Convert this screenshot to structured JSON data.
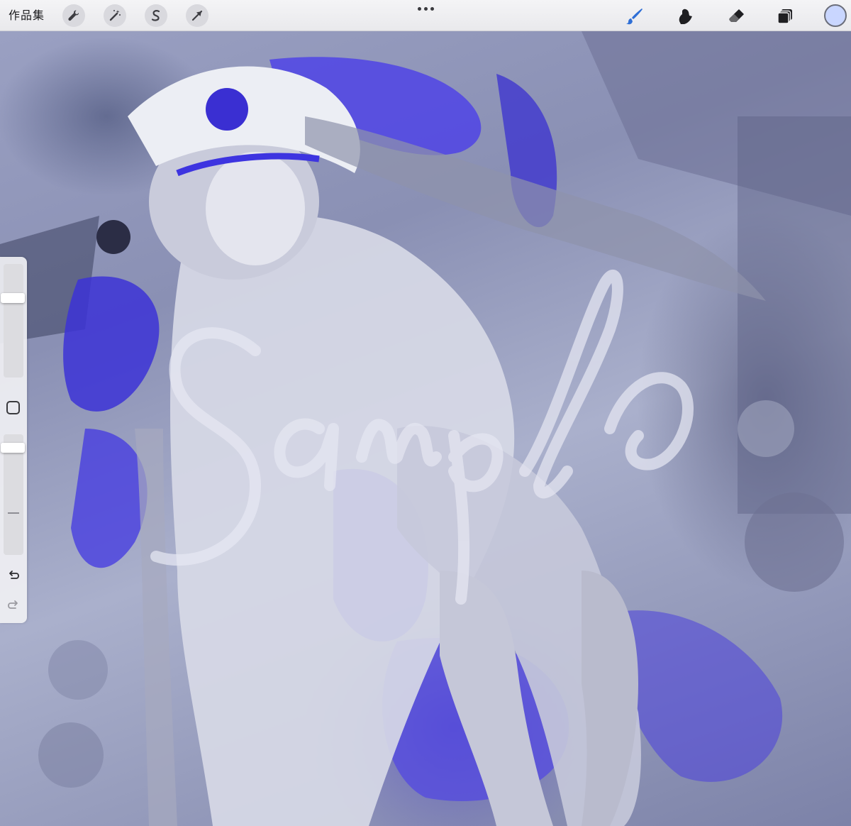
{
  "app": {
    "gallery_label": "作品集"
  },
  "toolbar": {
    "left_tools": [
      {
        "name": "actions",
        "icon": "wrench-icon"
      },
      {
        "name": "adjustments",
        "icon": "magic-wand-icon"
      },
      {
        "name": "selection",
        "icon": "selection-s-icon"
      },
      {
        "name": "transform",
        "icon": "arrow-cursor-icon"
      }
    ],
    "more_icon": "more-dots-icon",
    "right_tools": [
      {
        "name": "brush",
        "icon": "brush-icon",
        "active": true
      },
      {
        "name": "smudge",
        "icon": "smudge-icon",
        "active": false
      },
      {
        "name": "eraser",
        "icon": "eraser-icon",
        "active": false
      },
      {
        "name": "layers",
        "icon": "layers-icon",
        "active": false
      }
    ],
    "current_color": "#c9d6ff",
    "active_color": "#2f6fd6"
  },
  "sidebar": {
    "brush_size": 0.72,
    "brush_opacity": 0.92,
    "icons": [
      "modify-square-icon",
      "undo-icon",
      "redo-icon"
    ]
  },
  "canvas": {
    "watermark_icon": "sample-watermark-signature",
    "palette": [
      "#4a3fe0",
      "#8e93b3",
      "#d9dce8",
      "#3b3f63"
    ]
  }
}
